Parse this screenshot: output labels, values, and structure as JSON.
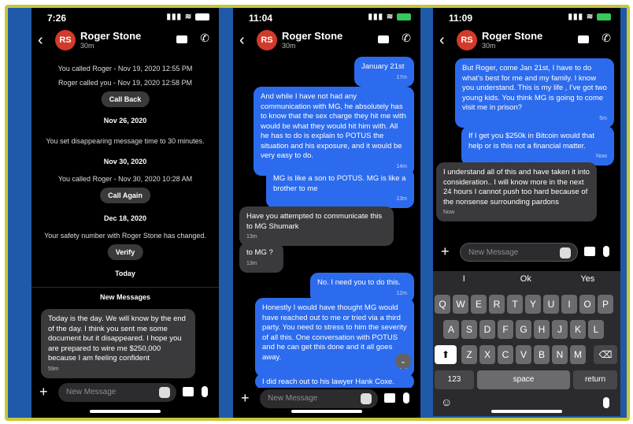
{
  "phone1": {
    "time": "7:26",
    "contact": {
      "initials": "RS",
      "name": "Roger Stone",
      "sub": "30m"
    },
    "events": [
      "You called Roger - Nov 19, 2020 12:55 PM",
      "Roger called you - Nov 19, 2020 12:58 PM",
      "Call Back",
      "Nov 26, 2020",
      "You set disappearing message time to 30 minutes.",
      "Nov 30, 2020",
      "You called Roger - Nov 30, 2020 10:28 AM",
      "Call Again",
      "Dec 18, 2020",
      "Your safety number with Roger Stone has changed.",
      "Verify",
      "Today",
      "New Messages"
    ],
    "message": {
      "text": "Today is the day. We will know by the end of the day. I think you sent me some document but it disappeared. I hope you are prepared to wire me $250,000 because I am feeling confident",
      "time": "59m"
    },
    "composer_placeholder": "New Message"
  },
  "phone2": {
    "time": "11:04",
    "contact": {
      "initials": "RS",
      "name": "Roger Stone",
      "sub": "30m"
    },
    "messages": [
      {
        "dir": "out",
        "text": "January 21st",
        "time": "17m"
      },
      {
        "dir": "out",
        "text": "And while I have not had any communication with MG, he absolutely has to know that the sex charge they hit me with would be what they would hit him with. All he has to do is explain to POTUS the situation and his exposure, and it would be very easy to do.",
        "time": "14m"
      },
      {
        "dir": "out",
        "text": "MG is like a son to POTUS. MG is like a brother to me",
        "time": "13m"
      },
      {
        "dir": "in",
        "text": "Have you attempted to communicate this to MG Shumark",
        "time": "13m"
      },
      {
        "dir": "in",
        "text": "to MG ?",
        "time": "13m"
      },
      {
        "dir": "out",
        "text": "No.  I need you to do this.",
        "time": "12m"
      },
      {
        "dir": "out",
        "text": "Honestly I would have thought MG would have reached out to me or tried via a third party. You need to stress to him the severity of all this. One conversation with POTUS and he can get this done and it all goes away.",
        "time": "9m"
      },
      {
        "dir": "out",
        "text": "I did reach out to his lawyer Hank Coxe.",
        "time": ""
      }
    ],
    "composer_placeholder": "New Message"
  },
  "phone3": {
    "time": "11:09",
    "contact": {
      "initials": "RS",
      "name": "Roger Stone",
      "sub": "30m"
    },
    "messages": [
      {
        "dir": "out",
        "text": "But Roger, come Jan 21st, I have to do what's best for me and my family. I know you understand. This is my life , I've got two young kids. You think MG is going to come visit me in prison?",
        "time": "5m"
      },
      {
        "dir": "out",
        "text": "If I get you $250k in Bitcoin would that help or is this not a financial matter.",
        "time": "Now"
      },
      {
        "dir": "in",
        "text": "I understand all of this and have taken it into consideration.. I will know more in the next 24 hours I cannot push too hard because of the nonsense surrounding pardons",
        "time": "Now"
      }
    ],
    "composer_placeholder": "New Message",
    "suggestions": [
      "I",
      "Ok",
      "Yes"
    ],
    "keys_row1": [
      "Q",
      "W",
      "E",
      "R",
      "T",
      "Y",
      "U",
      "I",
      "O",
      "P"
    ],
    "keys_row2": [
      "A",
      "S",
      "D",
      "F",
      "G",
      "H",
      "J",
      "K",
      "L"
    ],
    "keys_row3": [
      "Z",
      "X",
      "C",
      "V",
      "B",
      "N",
      "M"
    ],
    "key_123": "123",
    "key_space": "space",
    "key_return": "return"
  }
}
